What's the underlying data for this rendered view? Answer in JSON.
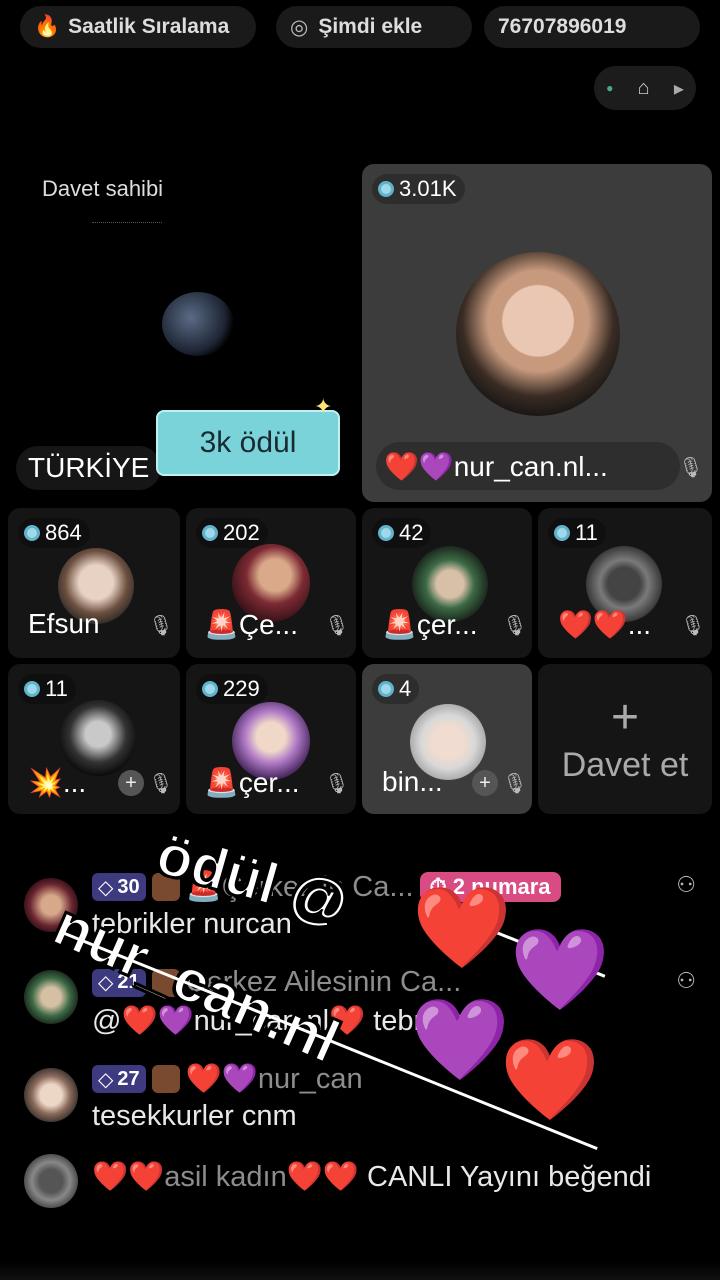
{
  "top_bar": {
    "ranking_label": "Saatlik Sıralama",
    "add_now_label": "Şimdi ekle",
    "room_id": "76707896019"
  },
  "host": {
    "label": "Davet sahibi",
    "country": "TÜRKİYE",
    "reward_badge": "3k ödül"
  },
  "featured": {
    "count": "3.01K",
    "name": "❤️💜nur_can.nl..."
  },
  "tiles_row1": [
    {
      "count": "864",
      "name": "Efsun"
    },
    {
      "count": "202",
      "name": "🚨Çe..."
    },
    {
      "count": "42",
      "name": "🚨çer..."
    },
    {
      "count": "11",
      "name": "❤️❤️..."
    }
  ],
  "tiles_row2": [
    {
      "count": "11",
      "name": "💥..."
    },
    {
      "count": "229",
      "name": "🚨çer..."
    },
    {
      "count": "4",
      "name": "bin..."
    }
  ],
  "invite": {
    "plus": "+",
    "label": "Davet et"
  },
  "chat": [
    {
      "level": "30",
      "name": "🚨Çerkez in Ca...",
      "rank": "2 numara",
      "message": "tebrikler nurcan"
    },
    {
      "level": "21",
      "name": "Çerkez Ailesinin Ca...",
      "message": "@❤️💜nur_can.nl❤️ tebrikler"
    },
    {
      "level": "27",
      "name": "❤️💜nur_can",
      "message": "tesekkurler cnm"
    },
    {
      "name": "❤️❤️asil kadın❤️❤️",
      "message": "CANLI Yayını beğendi"
    }
  ],
  "overlay": {
    "line1": "ödül @",
    "line2": "nur_can.nl"
  }
}
